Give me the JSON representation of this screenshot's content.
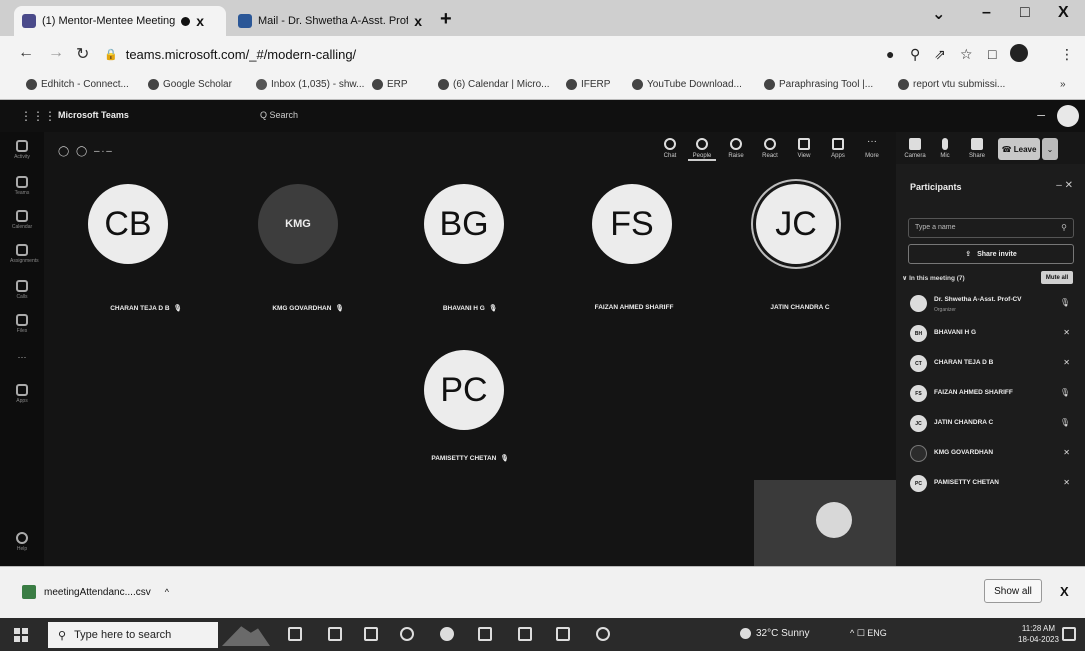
{
  "browser": {
    "tabs": [
      {
        "title": "(1) Mentor-Mentee Meeting",
        "icon": "teams-icon",
        "close": "x"
      },
      {
        "title": "Mail - Dr. Shwetha A-Asst. Prof-C",
        "icon": "outlook-icon",
        "close": "x"
      }
    ],
    "new_tab": "+",
    "window_controls": {
      "min": "–",
      "max": "□",
      "close": "X",
      "chevron": "⌄"
    },
    "url": "teams.microsoft.com/_#/modern-calling/",
    "bookmarks": [
      "Edhitch - Connect...",
      "Google Scholar",
      "Inbox (1,035) - shw...",
      "ERP",
      "(6) Calendar | Micro...",
      "IFERP",
      "YouTube Download...",
      "Paraphrasing Tool |...",
      "report vtu submissi..."
    ],
    "bookmarks_more": "»"
  },
  "teams": {
    "logo": "Microsoft Teams",
    "search_placeholder": "Q  Search",
    "rail": [
      {
        "label": "Activity"
      },
      {
        "label": "Teams"
      },
      {
        "label": "Calendar"
      },
      {
        "label": "Assignments"
      },
      {
        "label": "Calls"
      },
      {
        "label": "Files"
      },
      {
        "label": "···"
      },
      {
        "label": "Apps"
      },
      {
        "label": "Help"
      }
    ],
    "meeting_info": "◯ ◯ –∙–",
    "controls": [
      {
        "label": "Chat"
      },
      {
        "label": "People"
      },
      {
        "label": "Raise"
      },
      {
        "label": "React"
      },
      {
        "label": "View"
      },
      {
        "label": "Apps"
      },
      {
        "label": "More"
      }
    ],
    "av_controls": [
      {
        "label": "Camera"
      },
      {
        "label": "Mic"
      },
      {
        "label": "Share"
      }
    ],
    "leave_label": "☎ Leave",
    "leave_caret": "⌄",
    "tiles": [
      {
        "initials": "CB",
        "name": "CHARAN TEJA D B"
      },
      {
        "initials": "KMG",
        "name": "KMG GOVARDHAN"
      },
      {
        "initials": "BG",
        "name": "BHAVANI H G"
      },
      {
        "initials": "FS",
        "name": "FAIZAN AHMED SHARIFF"
      },
      {
        "initials": "JC",
        "name": "JATIN CHANDRA C"
      },
      {
        "initials": "PC",
        "name": "PAMISETTY CHETAN"
      }
    ],
    "participants_panel": {
      "title": "Participants",
      "search_placeholder": "Type a name",
      "share_invite": "Share invite",
      "in_meeting": "∨ In this meeting (7)",
      "mute_all": "Mute all",
      "people": [
        {
          "initials": "",
          "name": "Dr. Shwetha A-Asst. Prof-CV",
          "role": "Organizer"
        },
        {
          "initials": "BH",
          "name": "BHAVANI H G",
          "role": ""
        },
        {
          "initials": "CT",
          "name": "CHARAN TEJA D B",
          "role": ""
        },
        {
          "initials": "FS",
          "name": "FAIZAN AHMED SHARIFF",
          "role": ""
        },
        {
          "initials": "JC",
          "name": "JATIN CHANDRA C",
          "role": ""
        },
        {
          "initials": "",
          "name": "KMG GOVARDHAN",
          "role": ""
        },
        {
          "initials": "PC",
          "name": "PAMISETTY CHETAN",
          "role": ""
        }
      ]
    }
  },
  "download": {
    "file": "meetingAttendanc....csv",
    "caret": "^",
    "show_all": "Show all",
    "close": "X"
  },
  "taskbar": {
    "search_placeholder": "Type here to search",
    "weather": "32°C  Sunny",
    "tray": "^  ☐  ENG",
    "time": "11:28 AM",
    "date": "18-04-2023"
  }
}
